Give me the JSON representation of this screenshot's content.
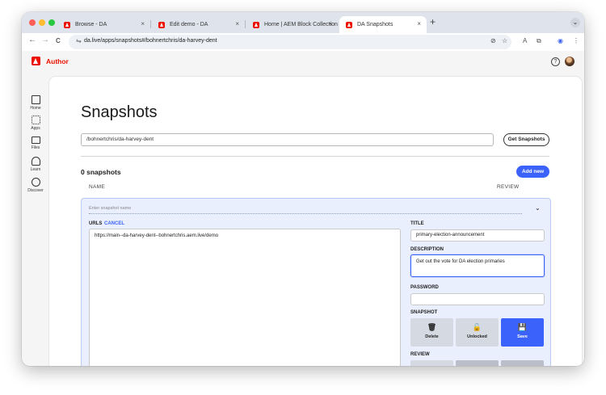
{
  "browser": {
    "tabs": [
      {
        "title": "Browse - DA",
        "active": false
      },
      {
        "title": "Edit demo - DA",
        "active": false
      },
      {
        "title": "Home | AEM Block Collection",
        "active": false
      },
      {
        "title": "DA Snapshots",
        "active": true
      }
    ],
    "close_glyph": "×",
    "new_tab_glyph": "+",
    "tab_menu_glyph": "⌄",
    "url": "da.live/apps/snapshots#/bohnertchris/da-harvey-dent",
    "icons": [
      "back-icon",
      "forward-icon",
      "reload-icon",
      "site-settings-icon",
      "eye-off-icon",
      "bookmark-star-icon",
      "translate-icon",
      "extensions-icon",
      "profile-icon",
      "menu-icon"
    ],
    "glyphs": {
      "back": "←",
      "forward": "→",
      "reload": "C",
      "tune": "⇋",
      "eye_off": "⊘",
      "star": "☆",
      "translate": "A",
      "ext": "⧉",
      "profile": "◉",
      "menu": "⋮"
    }
  },
  "app": {
    "brand": "Author",
    "help_glyph": "?",
    "brand_color": "#eb1000"
  },
  "sidebar": {
    "items": [
      {
        "label": "Home",
        "icon": "home-icon"
      },
      {
        "label": "Apps",
        "icon": "apps-icon"
      },
      {
        "label": "Files",
        "icon": "folder-icon"
      },
      {
        "label": "Learn",
        "icon": "lightbulb-icon"
      },
      {
        "label": "Discover",
        "icon": "compass-icon"
      }
    ]
  },
  "page": {
    "title": "Snapshots",
    "path_value": "/bohnertchris/da-harvey-dent",
    "get_button": "Get Snapshots",
    "count_label": "0 snapshots",
    "add_button": "Add new",
    "columns": {
      "name": "NAME",
      "review": "REVIEW"
    }
  },
  "editor": {
    "name_placeholder": "Enter snapshot name",
    "chevron": "⌄",
    "urls_label": "URLS",
    "cancel_label": "CANCEL",
    "urls_value": "https://main--da-harvey-dent--bohnertchris.aem.live/demo",
    "title_label": "TITLE",
    "title_value": "primary-election-announcement",
    "description_label": "DESCRIPTION",
    "description_value": "Get out the vote for DA election primaries",
    "password_label": "PASSWORD",
    "password_value": "",
    "snapshot_label": "SNAPSHOT",
    "snapshot_buttons": [
      {
        "label": "Delete",
        "icon": "trash-icon",
        "glyph": "🗑"
      },
      {
        "label": "Unlocked",
        "icon": "unlock-icon",
        "glyph": "🔓"
      },
      {
        "label": "Save",
        "icon": "save-icon",
        "glyph": "💾"
      }
    ],
    "review_label": "REVIEW",
    "accent_color": "#3b63fb"
  }
}
